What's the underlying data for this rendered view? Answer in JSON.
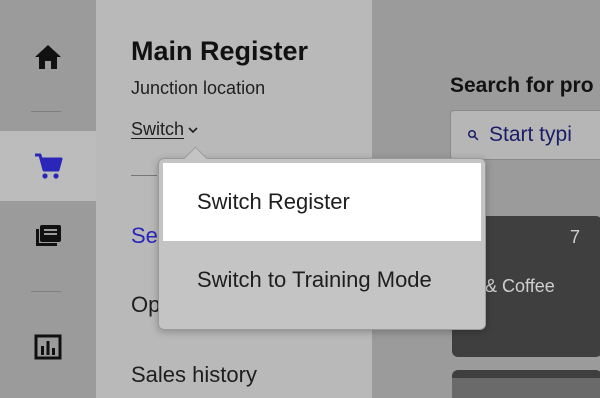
{
  "nav": {
    "items": [
      {
        "icon": "home-icon",
        "active": false
      },
      {
        "icon": "cart-icon",
        "active": true
      },
      {
        "icon": "products-icon",
        "active": false
      },
      {
        "icon": "reports-icon",
        "active": false
      }
    ]
  },
  "panel": {
    "title": "Main Register",
    "location": "Junction location",
    "switch_label": "Switch",
    "items": [
      "Sel",
      "Op",
      "Sales history"
    ]
  },
  "main": {
    "search_heading": "Search for pro",
    "search_placeholder": "Start typi",
    "tile": {
      "count": "7",
      "name": "ea & Coffee"
    }
  },
  "dropdown": {
    "items": [
      "Switch Register",
      "Switch to Training Mode"
    ]
  },
  "colors": {
    "accent": "#2a27b8",
    "overlay": "#9b9b9b",
    "menu_highlight": "#ffffff"
  }
}
